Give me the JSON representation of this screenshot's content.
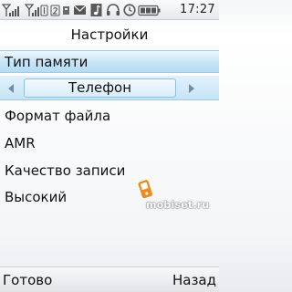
{
  "status_bar": {
    "time": "17:27",
    "icons": [
      "signal-strength-icon",
      "sim1-signal-icon",
      "sim2-signal-icon",
      "envelope-icon",
      "music-note-icon",
      "headset-icon",
      "clock-icon",
      "battery-icon"
    ]
  },
  "screen": {
    "title": "Настройки",
    "memory_type_label": "Тип памяти",
    "memory_type_value": "Телефон",
    "file_format_label": "Формат файла",
    "file_format_value": "AMR",
    "quality_label": "Качество записи",
    "quality_value": "Высокий"
  },
  "softkeys": {
    "left": "Готово",
    "right": "Назад"
  },
  "watermark": {
    "text": "mobiset.ru"
  },
  "colors": {
    "selection": "#c6e5f7",
    "selection_border": "#9ccbe8",
    "watermark_orange": "#f08a1c"
  }
}
